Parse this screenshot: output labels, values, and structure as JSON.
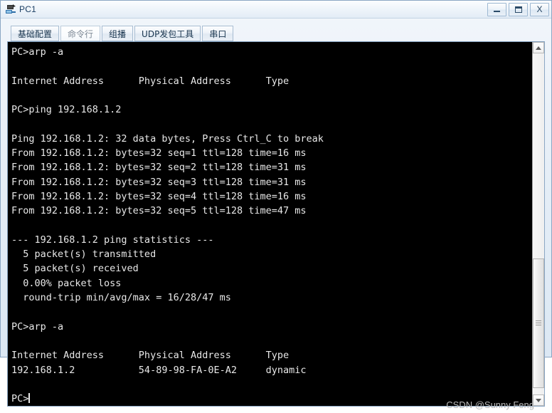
{
  "window": {
    "title": "PC1",
    "icon": "pc-device-icon",
    "buttons": {
      "minimize_label": "–",
      "maximize_label": "□",
      "close_label": "X"
    }
  },
  "tabs": [
    {
      "label": "基础配置",
      "name": "tab-basic-config",
      "active": false
    },
    {
      "label": "命令行",
      "name": "tab-command-line",
      "active": true
    },
    {
      "label": "组播",
      "name": "tab-multicast",
      "active": false
    },
    {
      "label": "UDP发包工具",
      "name": "tab-udp-tool",
      "active": false
    },
    {
      "label": "串口",
      "name": "tab-serial-port",
      "active": false
    }
  ],
  "terminal": {
    "prompt": "PC>",
    "lines": [
      "PC>arp -a",
      "",
      "Internet Address      Physical Address      Type",
      "",
      "PC>ping 192.168.1.2",
      "",
      "Ping 192.168.1.2: 32 data bytes, Press Ctrl_C to break",
      "From 192.168.1.2: bytes=32 seq=1 ttl=128 time=16 ms",
      "From 192.168.1.2: bytes=32 seq=2 ttl=128 time=31 ms",
      "From 192.168.1.2: bytes=32 seq=3 ttl=128 time=31 ms",
      "From 192.168.1.2: bytes=32 seq=4 ttl=128 time=16 ms",
      "From 192.168.1.2: bytes=32 seq=5 ttl=128 time=47 ms",
      "",
      "--- 192.168.1.2 ping statistics ---",
      "  5 packet(s) transmitted",
      "  5 packet(s) received",
      "  0.00% packet loss",
      "  round-trip min/avg/max = 16/28/47 ms",
      "",
      "PC>arp -a",
      "",
      "Internet Address      Physical Address      Type",
      "192.168.1.2           54-89-98-FA-0E-A2     dynamic",
      ""
    ],
    "ping_target": "192.168.1.2",
    "ping_bytes": 32,
    "ping_replies": [
      {
        "seq": 1,
        "bytes": 32,
        "ttl": 128,
        "time_ms": 16
      },
      {
        "seq": 2,
        "bytes": 32,
        "ttl": 128,
        "time_ms": 31
      },
      {
        "seq": 3,
        "bytes": 32,
        "ttl": 128,
        "time_ms": 31
      },
      {
        "seq": 4,
        "bytes": 32,
        "ttl": 128,
        "time_ms": 16
      },
      {
        "seq": 5,
        "bytes": 32,
        "ttl": 128,
        "time_ms": 47
      }
    ],
    "statistics": {
      "transmitted": 5,
      "received": 5,
      "packet_loss": "0.00%",
      "min_ms": 16,
      "avg_ms": 28,
      "max_ms": 47
    },
    "arp_table": {
      "headers": [
        "Internet Address",
        "Physical Address",
        "Type"
      ],
      "rows": [
        [
          "192.168.1.2",
          "54-89-98-FA-0E-A2",
          "dynamic"
        ]
      ]
    },
    "colors": {
      "background": "#000000",
      "text": "#e8e8e8"
    }
  },
  "scrollbar": {
    "up_arrow": "scroll-up-arrow-icon",
    "down_arrow": "scroll-down-arrow-icon",
    "thumb_top_percent": 60,
    "thumb_height_percent": 38
  },
  "watermark": {
    "text": "CSDN @Sunny Feng"
  }
}
